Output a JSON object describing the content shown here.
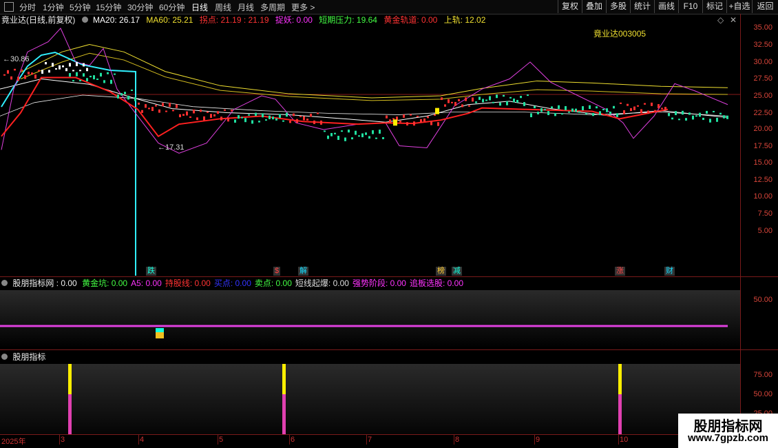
{
  "toolbar": {
    "tabs": [
      "分时",
      "1分钟",
      "5分钟",
      "15分钟",
      "30分钟",
      "60分钟",
      "日线",
      "周线",
      "月线",
      "多周期",
      "更多 >"
    ],
    "active_tab": "日线",
    "buttons": [
      "复权",
      "叠加",
      "多股",
      "统计",
      "画线",
      "F10",
      "标记",
      "+自选",
      "返回"
    ]
  },
  "main_panel": {
    "stock_label": "竟业达(日线,前复权)",
    "ma20": "MA20: 26.17",
    "ma60": "MA60: 25.21",
    "guai_dian": "拐点: 21.19",
    "guai_dian2": ": 21.19",
    "zhuo_yao": "捉妖: 0.00",
    "short_pressure": "短期压力: 19.64",
    "gold_track": "黄金轨道: 0.00",
    "upper_track": "上轨: 12.02",
    "stock_code_overlay": "竟业达003005",
    "high_marker": "30.86",
    "low_marker": "17.31",
    "y_ticks": [
      "35.00",
      "32.50",
      "30.00",
      "27.50",
      "25.00",
      "22.50",
      "20.00",
      "17.50",
      "15.00",
      "12.50",
      "10.00",
      "7.50",
      "5.00"
    ],
    "tags": [
      {
        "text": "跌",
        "color": "#1fd"
      },
      {
        "text": "$",
        "color": "#f44"
      },
      {
        "text": "解",
        "color": "#1df"
      },
      {
        "text": "榜",
        "color": "#fc3"
      },
      {
        "text": "减",
        "color": "#1fd"
      },
      {
        "text": "涨",
        "color": "#f44"
      },
      {
        "text": "财",
        "color": "#1df"
      }
    ]
  },
  "panel2": {
    "name": "股朋指标网",
    "value": ": 0.00",
    "items": [
      {
        "label": "黄金坑: 0.00",
        "color": "#4f4"
      },
      {
        "label": "A5: 0.00",
        "color": "#f3f"
      },
      {
        "label": "持股线: 0.00",
        "color": "#f33"
      },
      {
        "label": "买点: 0.00",
        "color": "#33f"
      },
      {
        "label": "卖点: 0.00",
        "color": "#4f4"
      },
      {
        "label": "短线起爆: 0.00",
        "color": "#ddd"
      },
      {
        "label": "强势阶段: 0.00",
        "color": "#f3f"
      },
      {
        "label": "追板选股: 0.00",
        "color": "#f3f"
      }
    ],
    "y_tick": "50.00"
  },
  "panel3": {
    "name": "股朋指标",
    "y_ticks": [
      "75.00",
      "50.00",
      "25.00"
    ]
  },
  "xaxis": {
    "labels": [
      "2025年",
      "3",
      "4",
      "5",
      "6",
      "7",
      "8",
      "9",
      "10"
    ]
  },
  "watermark": {
    "title": "股朋指标网",
    "url": "www.7gpzb.com"
  },
  "colors": {
    "axis": "#d8453a",
    "ma_white": "#ffffff",
    "ma_yellow": "#f0e030",
    "cyan": "#30f0ff",
    "magenta": "#e040e0",
    "red": "#ff2020",
    "green": "#20e0a0"
  }
}
